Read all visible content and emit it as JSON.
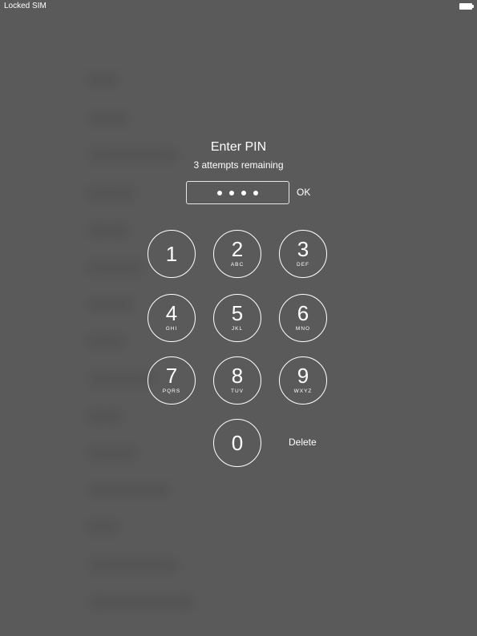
{
  "status_bar": {
    "carrier": "Locked SIM",
    "battery_icon": "battery-full-icon"
  },
  "prompt": {
    "title": "Enter PIN",
    "subtitle": "3 attempts remaining"
  },
  "pin_entry": {
    "entered_digits": 4,
    "ok_label": "OK"
  },
  "keypad": {
    "keys": [
      {
        "digit": "1",
        "letters": ""
      },
      {
        "digit": "2",
        "letters": "ABC"
      },
      {
        "digit": "3",
        "letters": "DEF"
      },
      {
        "digit": "4",
        "letters": "GHI"
      },
      {
        "digit": "5",
        "letters": "JKL"
      },
      {
        "digit": "6",
        "letters": "MNO"
      },
      {
        "digit": "7",
        "letters": "PQRS"
      },
      {
        "digit": "8",
        "letters": "TUV"
      },
      {
        "digit": "9",
        "letters": "WXYZ"
      },
      {
        "digit": "0",
        "letters": ""
      }
    ],
    "delete_label": "Delete"
  }
}
